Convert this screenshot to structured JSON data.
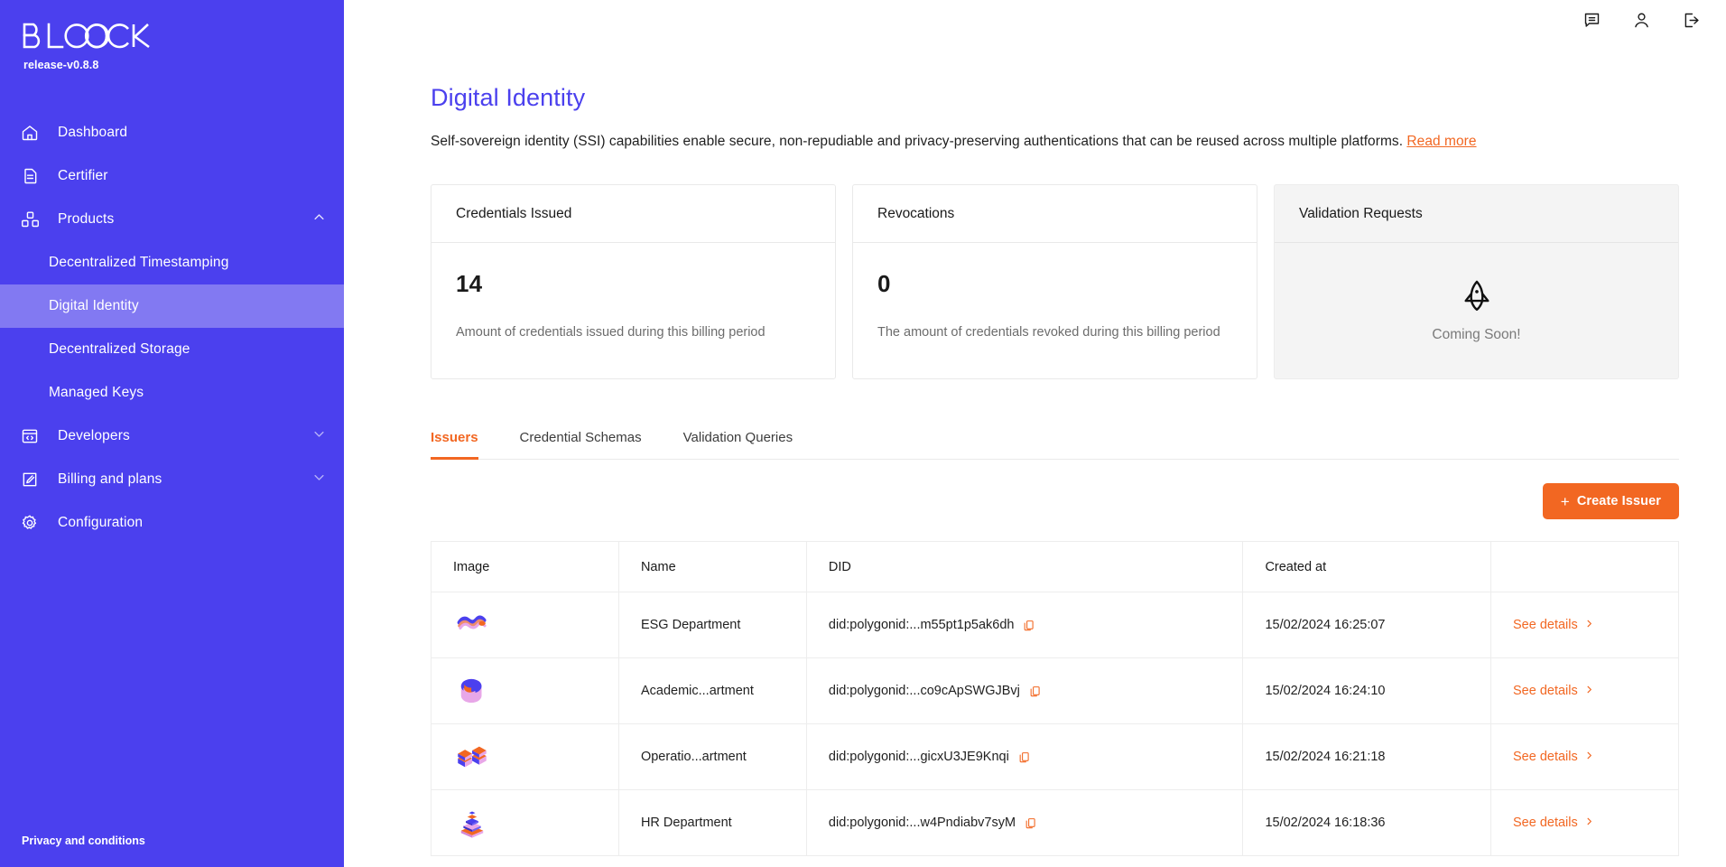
{
  "sidebar": {
    "logo_text": "BLOCK",
    "release": "release-v0.8.8",
    "items": [
      {
        "label": "Dashboard",
        "icon": "home-icon"
      },
      {
        "label": "Certifier",
        "icon": "document-icon"
      },
      {
        "label": "Products",
        "icon": "cubes-icon",
        "chevron": "chevron-up-icon"
      },
      {
        "label": "Developers",
        "icon": "code-window-icon",
        "chevron": "chevron-down-icon"
      },
      {
        "label": "Billing and plans",
        "icon": "edit-square-icon",
        "chevron": "chevron-down-icon"
      },
      {
        "label": "Configuration",
        "icon": "gear-icon"
      }
    ],
    "products_sub": [
      {
        "label": "Decentralized Timestamping",
        "active": false
      },
      {
        "label": "Digital Identity",
        "active": true
      },
      {
        "label": "Decentralized Storage",
        "active": false
      },
      {
        "label": "Managed Keys",
        "active": false
      }
    ],
    "privacy": "Privacy and conditions",
    "bg_color": "#4B40EE",
    "active_color": "#8279F2"
  },
  "topbar": {
    "icons": [
      "chat-icon",
      "user-icon",
      "logout-icon"
    ]
  },
  "page": {
    "title": "Digital Identity",
    "description": "Self-sovereign identity (SSI) capabilities enable secure, non-repudiable and privacy-preserving authentications that can be reused across multiple platforms.",
    "read_more": "Read more",
    "accent_color": "#F26722",
    "brand_color": "#4B40EE"
  },
  "cards": [
    {
      "title": "Credentials Issued",
      "value": "14",
      "subtitle": "Amount of credentials issued during this billing period",
      "muted": false
    },
    {
      "title": "Revocations",
      "value": "0",
      "subtitle": "The amount of credentials revoked during this billing period",
      "muted": false
    },
    {
      "title": "Validation Requests",
      "coming_soon": "Coming Soon!",
      "icon": "rocket-icon",
      "muted": true
    }
  ],
  "tabs": [
    {
      "label": "Issuers",
      "active": true
    },
    {
      "label": "Credential Schemas",
      "active": false
    },
    {
      "label": "Validation Queries",
      "active": false
    }
  ],
  "actions": {
    "create_issuer": "Create Issuer",
    "create_issuer_plus": "+"
  },
  "table": {
    "columns": [
      "Image",
      "Name",
      "DID",
      "Created at",
      ""
    ],
    "rows": [
      {
        "image": "issuer-avatar-squiggle",
        "name": "ESG Department",
        "did": "did:polygonid:...m55pt1p5ak6dh",
        "created_at": "15/02/2024 16:25:07",
        "details": "See details"
      },
      {
        "image": "issuer-avatar-cylinder",
        "name": "Academic...artment",
        "did": "did:polygonid:...co9cApSWGJBvj",
        "created_at": "15/02/2024 16:24:10",
        "details": "See details"
      },
      {
        "image": "issuer-avatar-blocks",
        "name": "Operatio...artment",
        "did": "did:polygonid:...gicxU3JE9Knqi",
        "created_at": "15/02/2024 16:21:18",
        "details": "See details"
      },
      {
        "image": "issuer-avatar-stack",
        "name": "HR Department",
        "did": "did:polygonid:...w4Pndiabv7syM",
        "created_at": "15/02/2024 16:18:36",
        "details": "See details"
      }
    ],
    "copy_icon": "copy-icon",
    "chevron_icon": "chevron-right-icon"
  }
}
